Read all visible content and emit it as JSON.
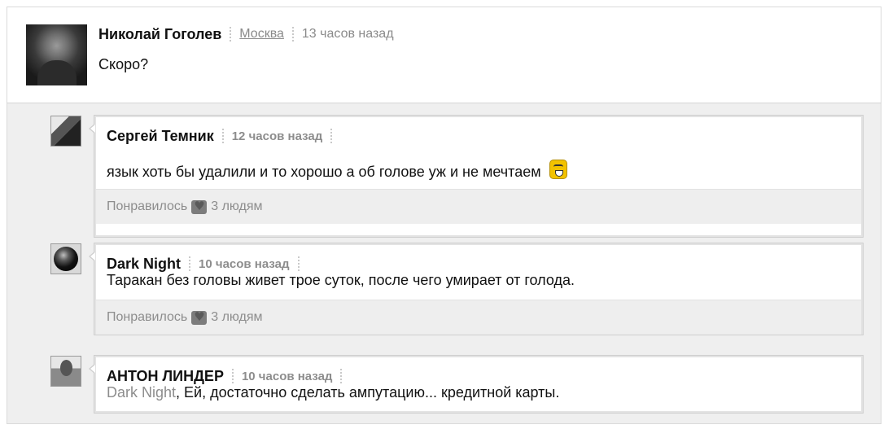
{
  "post": {
    "author": "Николай Гоголев",
    "location": "Москва",
    "time": "13 часов назад",
    "text": "Скоро?"
  },
  "comments": [
    {
      "author": "Сергей Темник",
      "time": "12 часов назад",
      "text": "язык хоть бы удалили и то хорошо а об голове уж и не мечтаем",
      "emoji": "smile-emoji-icon",
      "likes_label": "Понравилось",
      "likes_count": "3 людям"
    },
    {
      "author": "Dark Night",
      "time": "10 часов назад",
      "text": "Таракан без головы живет трое суток, после чего умирает от голода.",
      "likes_label": "Понравилось",
      "likes_count": "3 людям"
    },
    {
      "author": "АНТОН ЛИНДЕР",
      "time": "10 часов назад",
      "mention": "Dark Night",
      "text": ", Ей, достаточно сделать ампутацию... кредитной карты."
    }
  ]
}
